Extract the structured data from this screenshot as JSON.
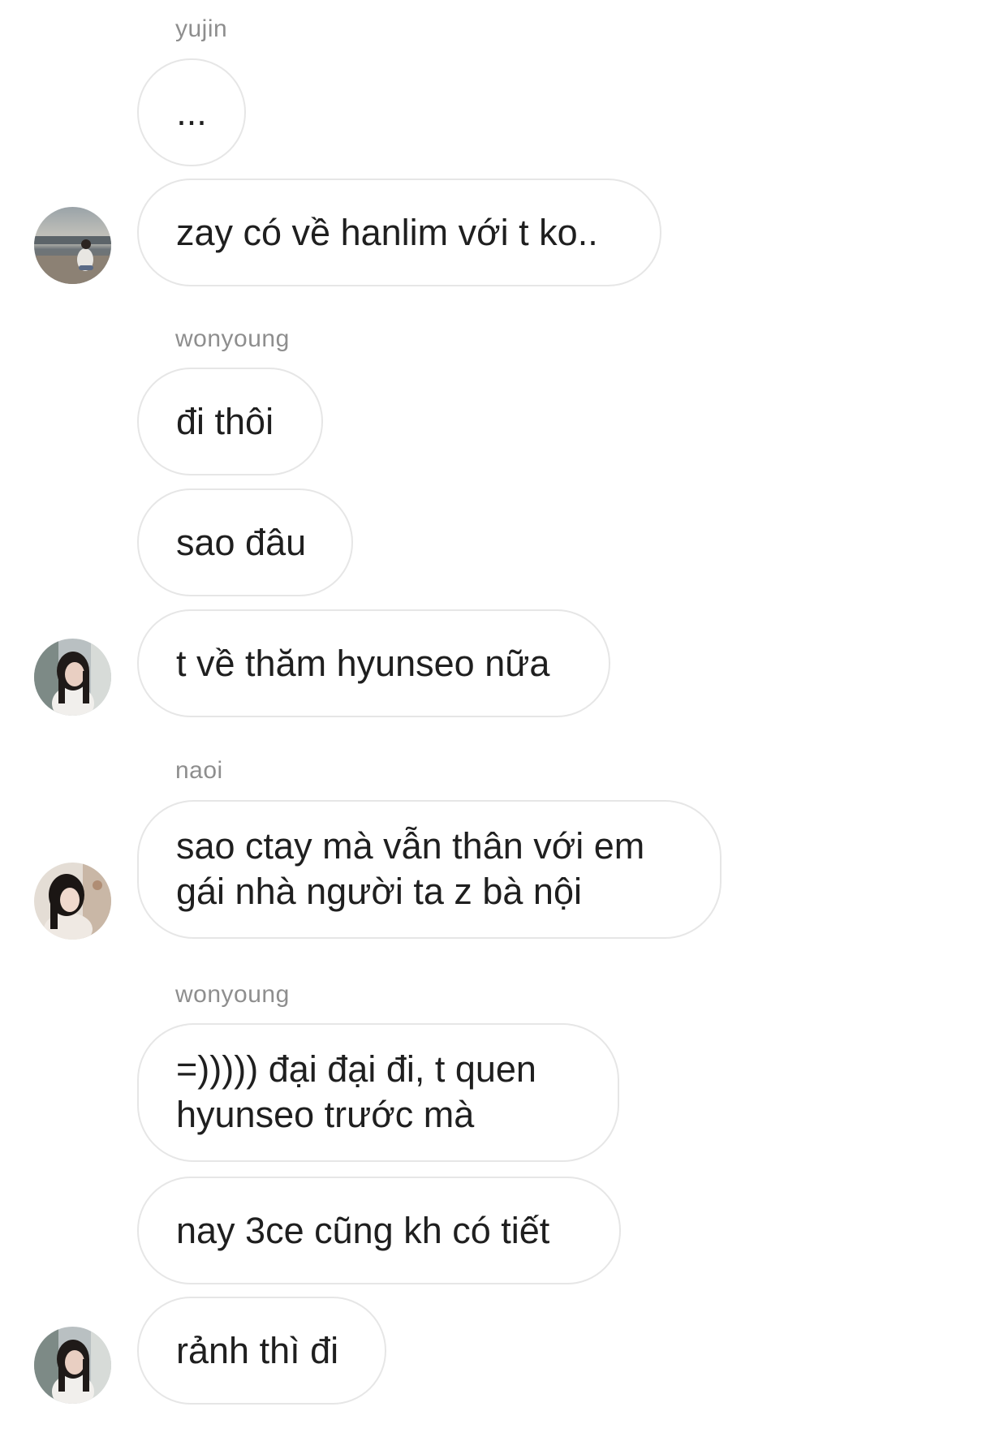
{
  "thread": {
    "groups": [
      {
        "sender": "yujin",
        "messages": [
          "...",
          "zay có về hanlim với t ko.."
        ]
      },
      {
        "sender": "wonyoung",
        "messages": [
          "đi thôi",
          "sao đâu",
          "t về thăm hyunseo nữa"
        ]
      },
      {
        "sender": "naoi",
        "messages": [
          "sao ctay mà vẫn thân với em\ngái nhà người ta z bà nội"
        ]
      },
      {
        "sender": "wonyoung",
        "messages": [
          "=))))) đại đại đi, t quen\nhyunseo trước mà",
          "nay 3ce cũng kh có tiết",
          "rảnh thì đi"
        ]
      }
    ]
  },
  "avatars": {
    "yujin": "avatar-beach-photo",
    "wonyoung": "avatar-portrait-photo",
    "naoi": "avatar-portrait-photo"
  },
  "colors": {
    "bubble_border": "#e6e6e6",
    "sender_label": "#8e8e8e",
    "text": "#1f1f1f",
    "background": "#ffffff"
  }
}
